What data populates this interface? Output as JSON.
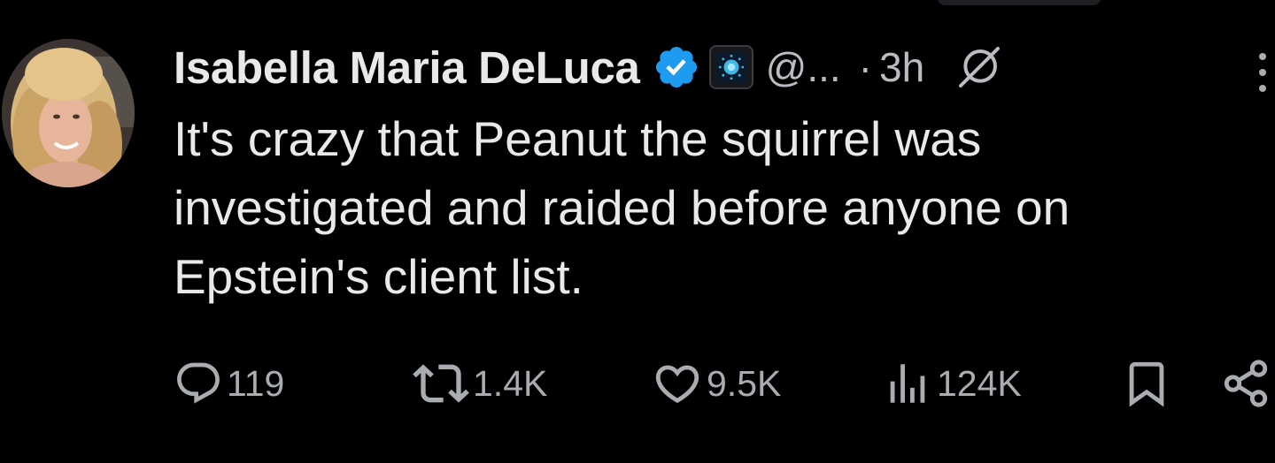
{
  "post": {
    "author": {
      "display_name": "Isabella Maria DeLuca",
      "handle": "@...",
      "verified": true
    },
    "separator": "·",
    "time": "3h",
    "text": "It's crazy that Peanut the squirrel was\ninvestigated and raided before anyone on\nEpstein's client list."
  },
  "actions": {
    "replies": "119",
    "reposts": "1.4K",
    "likes": "9.5K",
    "views": "124K"
  },
  "icons": {
    "verified": "verified-badge-icon",
    "affiliate": "affiliate-badge-icon",
    "grok": "grok-icon",
    "more": "more-vertical-icon",
    "reply": "reply-icon",
    "repost": "repost-icon",
    "like": "heart-icon",
    "views": "views-chart-icon",
    "bookmark": "bookmark-icon",
    "share": "share-icon"
  },
  "colors": {
    "background": "#000000",
    "text": "#e7e9ea",
    "secondary": "#b9bcc0",
    "verified_blue": "#1d9bf0"
  }
}
